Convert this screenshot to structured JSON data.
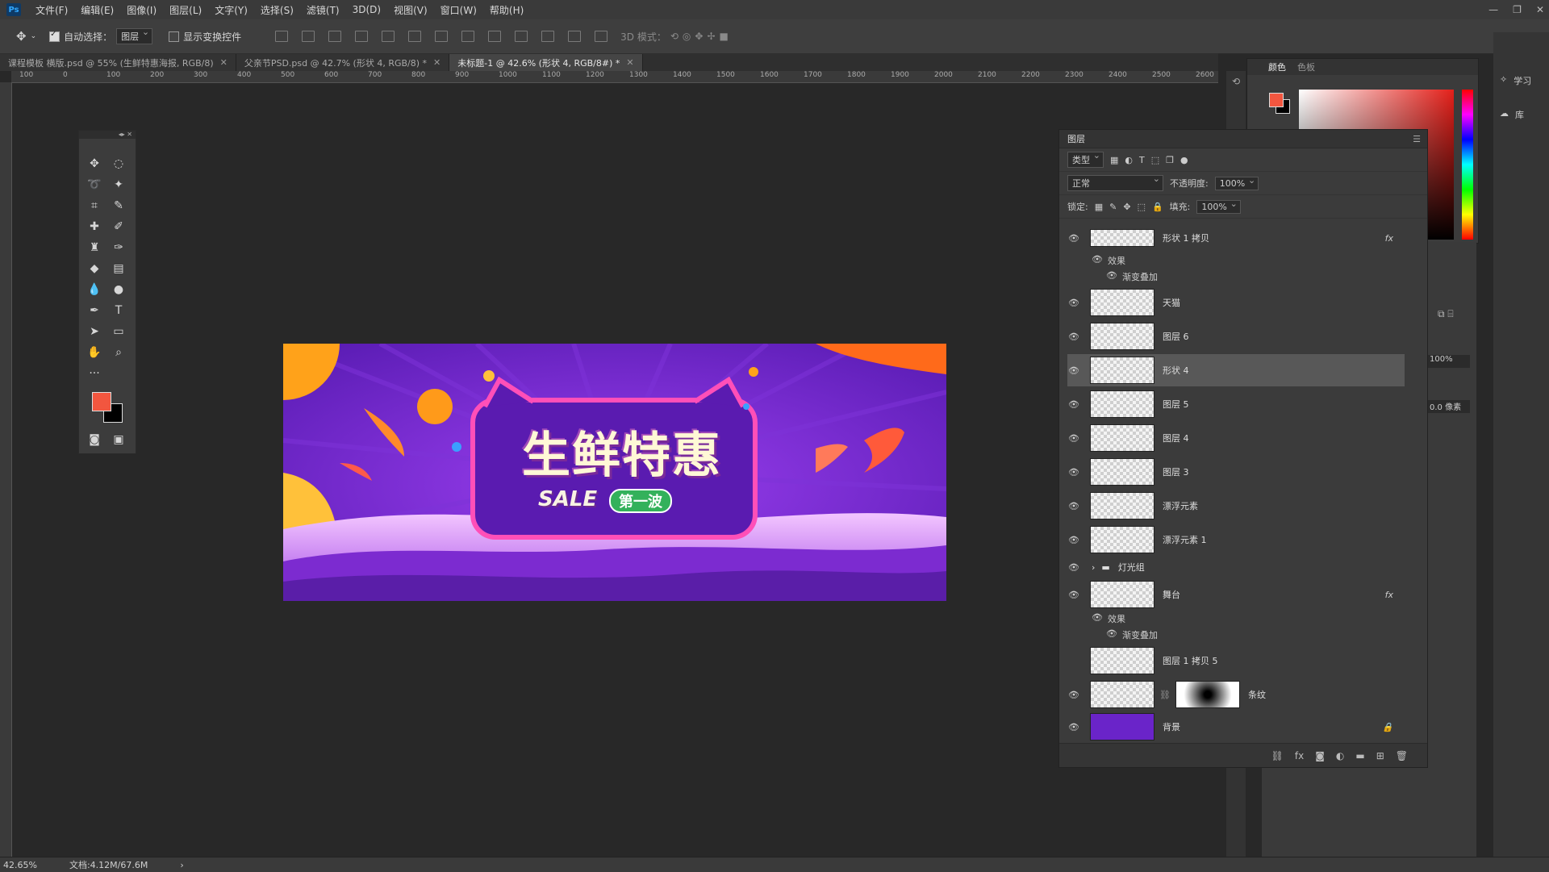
{
  "app": {
    "logo": "Ps"
  },
  "menu": [
    "文件(F)",
    "编辑(E)",
    "图像(I)",
    "图层(L)",
    "文字(Y)",
    "选择(S)",
    "滤镜(T)",
    "3D(D)",
    "视图(V)",
    "窗口(W)",
    "帮助(H)"
  ],
  "options": {
    "auto_select_label": "自动选择：",
    "auto_select_value": "图层",
    "show_transform_label": "显示变换控件",
    "mode_3d_label": "3D 模式："
  },
  "tabs": [
    {
      "label": "课程模板 横版.psd @ 55% (生鲜特惠海报, RGB/8)",
      "active": false
    },
    {
      "label": "父亲节PSD.psd @ 42.7% (形状 4, RGB/8) *",
      "active": false
    },
    {
      "label": "未标题-1 @ 42.6% (形状 4, RGB/8#) *",
      "active": true
    }
  ],
  "ruler_ticks": [
    "100",
    "0",
    "100",
    "200",
    "300",
    "400",
    "500",
    "600",
    "700",
    "800",
    "900",
    "1000",
    "1100",
    "1200",
    "1300",
    "1400",
    "1500",
    "1600",
    "1700",
    "1800",
    "1900",
    "2000",
    "2100",
    "2200",
    "2300",
    "2400",
    "2500",
    "2600"
  ],
  "banner": {
    "title": "生鲜特惠",
    "sale": "SALE",
    "badge": "第一波",
    "colors": {
      "bg": "#6a24c9",
      "accent": "#ff7a1a",
      "yellow": "#ffb21a"
    }
  },
  "color_panel": {
    "tabs": [
      "颜色",
      "色板"
    ],
    "fg": "#f2563f",
    "bg": "#000000"
  },
  "layers_panel": {
    "title": "图层",
    "filter_kind": "类型",
    "blend_mode": "正常",
    "opacity_label": "不透明度:",
    "opacity_value": "100%",
    "lock_label": "锁定:",
    "fill_label": "填充:",
    "fill_value": "100%",
    "layers": [
      {
        "name": "形状 1 拷贝",
        "visible": true,
        "fx": true,
        "effects_label": "效果",
        "effect": "渐变叠加"
      },
      {
        "name": "天猫",
        "visible": true
      },
      {
        "name": "图层 6",
        "visible": true
      },
      {
        "name": "形状 4",
        "visible": true,
        "selected": true
      },
      {
        "name": "图层 5",
        "visible": true
      },
      {
        "name": "图层 4",
        "visible": true
      },
      {
        "name": "图层 3",
        "visible": true
      },
      {
        "name": "漂浮元素",
        "visible": true
      },
      {
        "name": "漂浮元素 1",
        "visible": true
      },
      {
        "name": "灯光组",
        "visible": true,
        "group": true
      },
      {
        "name": "舞台",
        "visible": true,
        "fx": true,
        "effects_label": "效果",
        "effect": "渐变叠加"
      },
      {
        "name": "图层 1 拷贝 5",
        "visible": false
      },
      {
        "name": "条纹",
        "visible": true,
        "mask": true
      },
      {
        "name": "背景",
        "visible": true,
        "locked": true
      }
    ]
  },
  "right_panel": {
    "learn_label": "学习",
    "lib_label": "库",
    "pct": "100%",
    "px_value": "0.0 像素"
  },
  "status": {
    "zoom": "42.65%",
    "doc": "文档:4.12M/67.6M"
  }
}
